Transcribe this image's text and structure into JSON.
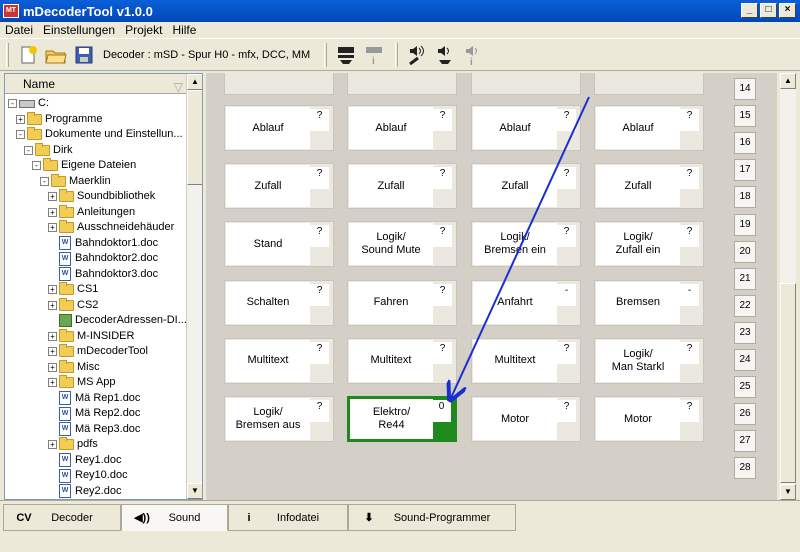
{
  "window": {
    "title": "mDecoderTool v1.0.0",
    "app_icon": "MT",
    "min": "_",
    "max": "□",
    "close": "×"
  },
  "menu": [
    "Datei",
    "Einstellungen",
    "Projekt",
    "Hilfe"
  ],
  "toolbar": {
    "decoder_info": "Decoder : mSD - Spur H0 - mfx, DCC, MM"
  },
  "tree": {
    "header": "Name",
    "items": [
      {
        "label": "C:",
        "indent": 0,
        "kind": "drive",
        "exp": "-"
      },
      {
        "label": "Programme",
        "indent": 1,
        "kind": "folder",
        "exp": "+"
      },
      {
        "label": "Dokumente und Einstellun...",
        "indent": 1,
        "kind": "folder",
        "exp": "-"
      },
      {
        "label": "Dirk",
        "indent": 2,
        "kind": "folder",
        "exp": "-"
      },
      {
        "label": "Eigene Dateien",
        "indent": 3,
        "kind": "folder",
        "exp": "-"
      },
      {
        "label": "Maerklin",
        "indent": 4,
        "kind": "folder",
        "exp": "-"
      },
      {
        "label": "Soundbibliothek",
        "indent": 5,
        "kind": "folder",
        "exp": "+"
      },
      {
        "label": "Anleitungen",
        "indent": 5,
        "kind": "folder",
        "exp": "+"
      },
      {
        "label": "Ausschneidehäuder",
        "indent": 5,
        "kind": "folder",
        "exp": "+"
      },
      {
        "label": "Bahndoktor1.doc",
        "indent": 5,
        "kind": "doc",
        "exp": ""
      },
      {
        "label": "Bahndoktor2.doc",
        "indent": 5,
        "kind": "doc",
        "exp": ""
      },
      {
        "label": "Bahndoktor3.doc",
        "indent": 5,
        "kind": "doc",
        "exp": ""
      },
      {
        "label": "CS1",
        "indent": 5,
        "kind": "folder",
        "exp": "+"
      },
      {
        "label": "CS2",
        "indent": 5,
        "kind": "folder",
        "exp": "+"
      },
      {
        "label": "DecoderAdressen-DI...",
        "indent": 5,
        "kind": "dfile",
        "exp": ""
      },
      {
        "label": "M-INSIDER",
        "indent": 5,
        "kind": "folder",
        "exp": "+"
      },
      {
        "label": "mDecoderTool",
        "indent": 5,
        "kind": "folder",
        "exp": "+"
      },
      {
        "label": "Misc",
        "indent": 5,
        "kind": "folder",
        "exp": "+"
      },
      {
        "label": "MS App",
        "indent": 5,
        "kind": "folder",
        "exp": "+"
      },
      {
        "label": "Mä Rep1.doc",
        "indent": 5,
        "kind": "doc",
        "exp": ""
      },
      {
        "label": "Mä Rep2.doc",
        "indent": 5,
        "kind": "doc",
        "exp": ""
      },
      {
        "label": "Mä Rep3.doc",
        "indent": 5,
        "kind": "doc",
        "exp": ""
      },
      {
        "label": "pdfs",
        "indent": 5,
        "kind": "folder",
        "exp": "+"
      },
      {
        "label": "Rey1.doc",
        "indent": 5,
        "kind": "doc",
        "exp": ""
      },
      {
        "label": "Rey10.doc",
        "indent": 5,
        "kind": "doc",
        "exp": ""
      },
      {
        "label": "Rey2.doc",
        "indent": 5,
        "kind": "doc",
        "exp": ""
      }
    ]
  },
  "grid": {
    "rows": [
      {
        "tiles": [
          {
            "label": "Ablauf",
            "value": "?"
          },
          {
            "label": "Ablauf",
            "value": "?"
          },
          {
            "label": "Ablauf",
            "value": "?"
          },
          {
            "label": "Ablauf",
            "value": "?"
          }
        ]
      },
      {
        "tiles": [
          {
            "label": "Zufall",
            "value": "?"
          },
          {
            "label": "Zufall",
            "value": "?"
          },
          {
            "label": "Zufall",
            "value": "?"
          },
          {
            "label": "Zufall",
            "value": "?"
          }
        ]
      },
      {
        "tiles": [
          {
            "label": "Stand",
            "value": "?"
          },
          {
            "label": "Logik/\nSound Mute",
            "value": "?"
          },
          {
            "label": "Logik/\nBremsen ein",
            "value": "?"
          },
          {
            "label": "Logik/\nZufall ein",
            "value": "?"
          }
        ]
      },
      {
        "tiles": [
          {
            "label": "Schalten",
            "value": "?"
          },
          {
            "label": "Fahren",
            "value": "?"
          },
          {
            "label": "Anfahrt",
            "value": "-"
          },
          {
            "label": "Bremsen",
            "value": "-"
          }
        ]
      },
      {
        "tiles": [
          {
            "label": "Multitext",
            "value": "?"
          },
          {
            "label": "Multitext",
            "value": "?"
          },
          {
            "label": "Multitext",
            "value": "?"
          },
          {
            "label": "Logik/\nMan Starkl",
            "value": "?"
          }
        ]
      },
      {
        "tiles": [
          {
            "label": "Logik/\nBremsen aus",
            "value": "?"
          },
          {
            "label": "Elektro/\nRe44",
            "value": "0",
            "active": true
          },
          {
            "label": "Motor",
            "value": "?"
          },
          {
            "label": "Motor",
            "value": "?"
          }
        ]
      }
    ],
    "row_numbers": [
      "14",
      "15",
      "16",
      "17",
      "18",
      "19",
      "20",
      "21",
      "22",
      "23",
      "24",
      "25",
      "26",
      "27",
      "28"
    ]
  },
  "tabs": [
    {
      "icon": "CV",
      "label": "Decoder"
    },
    {
      "icon": "◀))",
      "label": "Sound",
      "active": true
    },
    {
      "icon": "i",
      "label": "Infodatei"
    },
    {
      "icon": "⬇",
      "label": "Sound-Programmer"
    }
  ],
  "colors": {
    "active_tile": "#1e8a1e",
    "arrow": "#1a2fcf",
    "titlebar": "#0a5fd8"
  }
}
